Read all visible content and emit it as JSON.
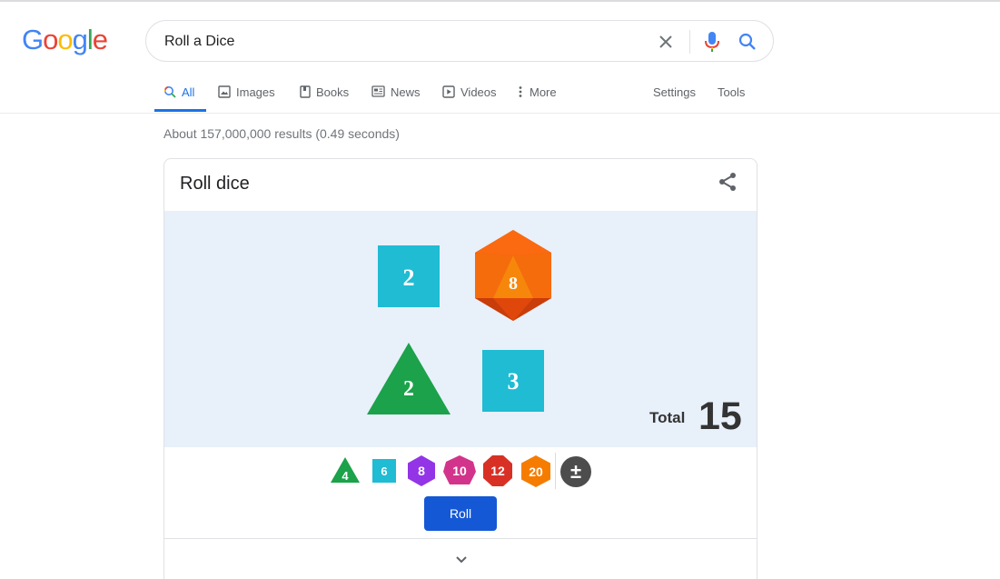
{
  "logo": {
    "letters": [
      "G",
      "o",
      "o",
      "g",
      "l",
      "e"
    ],
    "colors": [
      "#4285f4",
      "#ea4335",
      "#fbbc05",
      "#4285f4",
      "#34a853",
      "#ea4335"
    ]
  },
  "search": {
    "value": "Roll a Dice",
    "icons": {
      "clear": "close-icon",
      "mic": "microphone-icon",
      "search": "search-icon"
    }
  },
  "tabs": [
    {
      "label": "All",
      "icon": "search-icon",
      "active": true
    },
    {
      "label": "Images",
      "icon": "image-icon",
      "active": false
    },
    {
      "label": "Books",
      "icon": "book-icon",
      "active": false
    },
    {
      "label": "News",
      "icon": "news-icon",
      "active": false
    },
    {
      "label": "Videos",
      "icon": "play-icon",
      "active": false
    },
    {
      "label": "More",
      "icon": "more-vert-icon",
      "active": false
    }
  ],
  "tools": {
    "settings": "Settings",
    "tools": "Tools"
  },
  "result_stats": "About 157,000,000 results (0.49 seconds)",
  "card": {
    "title": "Roll dice",
    "share_icon": "share-icon",
    "dice": [
      {
        "sides": 6,
        "value": "2",
        "color": "#1fbcd3"
      },
      {
        "sides": 20,
        "value": "8",
        "color": "#f65a0b"
      },
      {
        "sides": 4,
        "value": "2",
        "color": "#1ba24a"
      },
      {
        "sides": 6,
        "value": "3",
        "color": "#1fbcd3"
      }
    ],
    "total_label": "Total",
    "total_value": "15",
    "picker": [
      {
        "sides": 4,
        "label": "4",
        "color": "#1ba24a"
      },
      {
        "sides": 6,
        "label": "6",
        "color": "#1fbcd3"
      },
      {
        "sides": 8,
        "label": "8",
        "color": "#9334e6"
      },
      {
        "sides": 10,
        "label": "10",
        "color": "#d3348b"
      },
      {
        "sides": 12,
        "label": "12",
        "color": "#d93025"
      },
      {
        "sides": 20,
        "label": "20",
        "color": "#f57c00"
      }
    ],
    "modifier_label": "±",
    "modifier_color": "#4d4d4d",
    "roll_label": "Roll",
    "roll_color": "#1558d6",
    "expand_icon": "chevron-down-icon"
  }
}
